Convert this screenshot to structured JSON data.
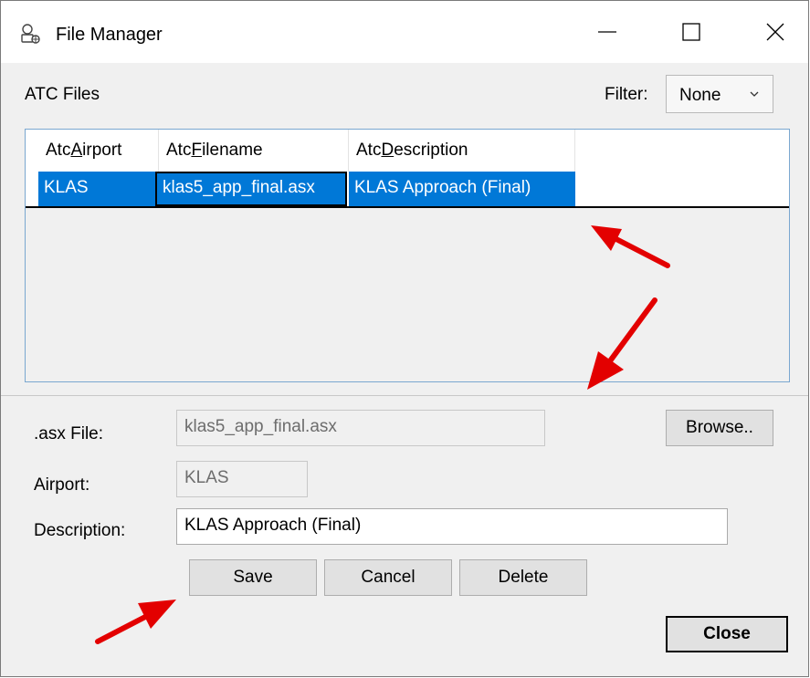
{
  "window": {
    "title": "File Manager",
    "icon": "file-manager-icon",
    "controls": [
      "minimize-icon",
      "maximize-icon",
      "close-icon"
    ]
  },
  "files_section": {
    "label": "ATC Files",
    "filter_label": "Filter:",
    "filter_value": "None"
  },
  "grid": {
    "columns": [
      {
        "prefix": "Atc",
        "accel": "A",
        "suffix": "irport"
      },
      {
        "prefix": "Atc",
        "accel": "F",
        "suffix": "ilename"
      },
      {
        "prefix": "Atc",
        "accel": "D",
        "suffix": "escription"
      }
    ],
    "rows": [
      {
        "airport": "KLAS",
        "filename": "klas5_app_final.asx",
        "description": "KLAS Approach (Final)"
      }
    ]
  },
  "form": {
    "asx_label": ".asx File:",
    "asx_value": "klas5_app_final.asx",
    "browse_label": "Browse..",
    "airport_label": "Airport:",
    "airport_value": "KLAS",
    "description_label": "Description:",
    "description_value": "KLAS Approach (Final)"
  },
  "buttons": {
    "save": "Save",
    "cancel": "Cancel",
    "delete": "Delete",
    "close": "Close"
  },
  "colors": {
    "selection": "#0078d7",
    "annotation_arrow": "#e30000",
    "dialog_background": "#f0f0f0"
  }
}
